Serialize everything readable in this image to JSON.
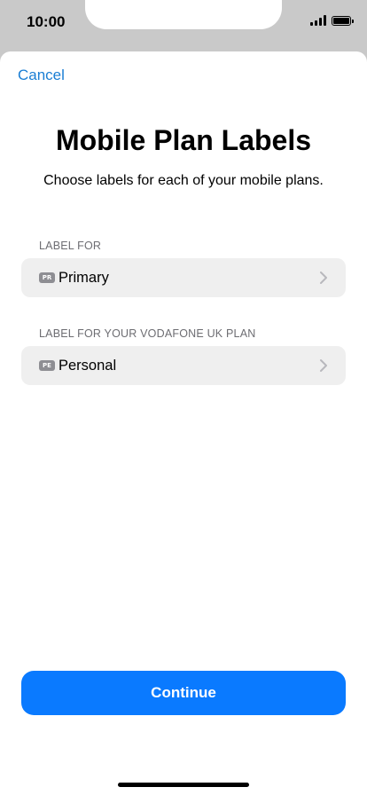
{
  "status_bar": {
    "time": "10:00",
    "icons": [
      "cellular-signal-icon",
      "battery-icon"
    ]
  },
  "header": {
    "cancel_label": "Cancel",
    "title": "Mobile Plan Labels",
    "subtitle": "Choose labels for each of your mobile plans."
  },
  "sections": [
    {
      "header": "LABEL FOR",
      "badge": "PR",
      "value": "Primary"
    },
    {
      "header": "LABEL FOR YOUR VODAFONE UK PLAN",
      "badge": "PE",
      "value": "Personal"
    }
  ],
  "footer": {
    "continue_label": "Continue"
  },
  "colors": {
    "accent": "#0a7aff",
    "link": "#1a7ed4",
    "row_background": "#efefef",
    "section_label": "#6d6d72",
    "badge": "#8e8e93"
  }
}
